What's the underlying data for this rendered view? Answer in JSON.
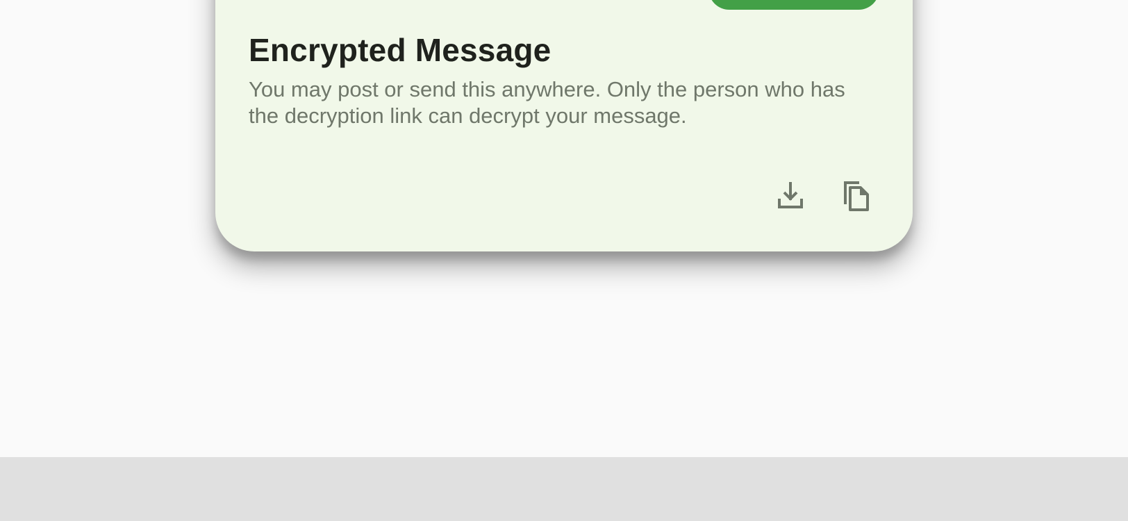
{
  "card": {
    "title": "Encrypted Message",
    "description": "You may post or send this anywhere. Only the person who has the decryption link can decrypt your message."
  },
  "actions": {
    "download_icon": "download-icon",
    "copy_icon": "copy-icon"
  },
  "colors": {
    "page_background": "#fafafa",
    "card_background": "#f1f8e9",
    "accent_green": "#43a047",
    "title_text": "#1f221d",
    "body_text": "#6f776a",
    "icon": "#6f776a",
    "bottom_bar": "#e0e0e0"
  }
}
